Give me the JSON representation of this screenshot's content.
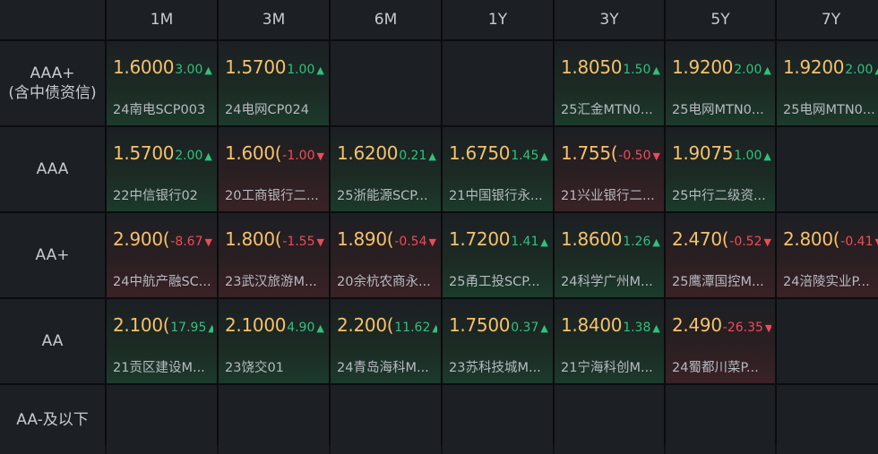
{
  "header": {
    "tenors": [
      "1M",
      "3M",
      "6M",
      "1Y",
      "3Y",
      "5Y",
      "7Y"
    ]
  },
  "rows": [
    {
      "label_line1": "AAA+",
      "label_line2": "(含中债资信)",
      "cells": [
        {
          "yield": "1.6000",
          "chg": "3.00",
          "dir": "up",
          "name": "24南电SCP003"
        },
        {
          "yield": "1.5700",
          "chg": "1.00",
          "dir": "up",
          "name": "24电网CP024"
        },
        null,
        null,
        {
          "yield": "1.8050",
          "chg": "1.50",
          "dir": "up",
          "name": "25汇金MTN0..."
        },
        {
          "yield": "1.9200",
          "chg": "2.00",
          "dir": "up",
          "name": "25电网MTN0..."
        },
        {
          "yield": "1.9200",
          "chg": "2.00",
          "dir": "up",
          "name": "25电网MTN0..."
        }
      ]
    },
    {
      "label_line1": "AAA",
      "label_line2": "",
      "cells": [
        {
          "yield": "1.5700",
          "chg": "2.00",
          "dir": "up",
          "name": "22中信银行02"
        },
        {
          "yield": "1.600(",
          "chg": "-1.00",
          "dir": "down",
          "name": "20工商银行二..."
        },
        {
          "yield": "1.6200",
          "chg": "0.21",
          "dir": "up",
          "name": "25浙能源SCP..."
        },
        {
          "yield": "1.6750",
          "chg": "1.45",
          "dir": "up",
          "name": "21中国银行永..."
        },
        {
          "yield": "1.755(",
          "chg": "-0.50",
          "dir": "down",
          "name": "21兴业银行二..."
        },
        {
          "yield": "1.9075",
          "chg": "1.00",
          "dir": "up",
          "name": "25中行二级资..."
        },
        null
      ]
    },
    {
      "label_line1": "AA+",
      "label_line2": "",
      "cells": [
        {
          "yield": "2.900(",
          "chg": "-8.67",
          "dir": "down",
          "name": "24中航产融SC..."
        },
        {
          "yield": "1.800(",
          "chg": "-1.55",
          "dir": "down",
          "name": "23武汉旅游M..."
        },
        {
          "yield": "1.890(",
          "chg": "-0.54",
          "dir": "down",
          "name": "20余杭农商永..."
        },
        {
          "yield": "1.7200",
          "chg": "1.41",
          "dir": "up",
          "name": "25甬工投SCP..."
        },
        {
          "yield": "1.8600",
          "chg": "1.26",
          "dir": "up",
          "name": "24科学广州M..."
        },
        {
          "yield": "2.470(",
          "chg": "-0.52",
          "dir": "down",
          "name": "25鹰潭国控M..."
        },
        {
          "yield": "2.800(",
          "chg": "-0.41",
          "dir": "down",
          "name": "24涪陵实业P..."
        }
      ]
    },
    {
      "label_line1": "AA",
      "label_line2": "",
      "cells": [
        {
          "yield": "2.100(",
          "chg": "17.95",
          "dir": "up",
          "name": "21贡区建设M..."
        },
        {
          "yield": "2.1000",
          "chg": "4.90",
          "dir": "up",
          "name": "23饶交01"
        },
        {
          "yield": "2.200(",
          "chg": "11.62",
          "dir": "up",
          "name": "24青岛海科M..."
        },
        {
          "yield": "1.7500",
          "chg": "0.37",
          "dir": "up",
          "name": "23苏科技城M..."
        },
        {
          "yield": "1.8400",
          "chg": "1.38",
          "dir": "up",
          "name": "21宁海科创M..."
        },
        {
          "yield": "2.490",
          "chg": "-26.35",
          "dir": "down",
          "name": "24蜀都川菜P..."
        },
        null
      ]
    },
    {
      "label_line1": "AA-及以下",
      "label_line2": "",
      "cells": [
        null,
        null,
        null,
        null,
        null,
        null,
        null
      ]
    }
  ],
  "icons": {
    "up": "triangle-up-icon",
    "down": "triangle-down-icon"
  },
  "colors": {
    "yield": "#f5c26b",
    "up": "#2ec27e",
    "down": "#ef4b57"
  }
}
